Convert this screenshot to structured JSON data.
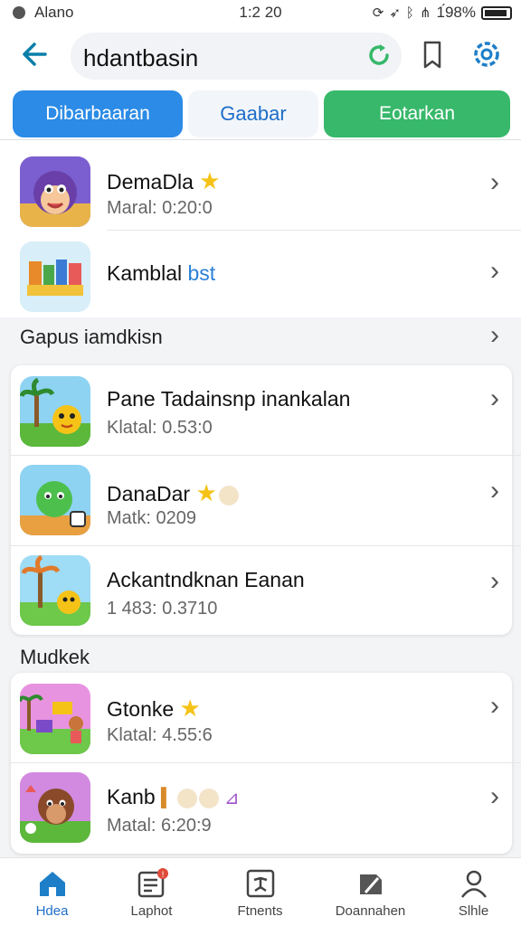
{
  "status": {
    "carrier": "Alano",
    "time": "1:2 20",
    "battery": "1́98%"
  },
  "search": {
    "query": "hdantbasin"
  },
  "tabs": [
    "Dibarbaaran",
    "Gaabar",
    "Eotarkan"
  ],
  "apps_top": [
    {
      "title": "DemaDla",
      "sub": "Maral: 0:20:0",
      "icon": "purple-monster-icon"
    },
    {
      "title": "Kamblal",
      "title_accent": "bst",
      "sub": "",
      "icon": "blocks-game-icon"
    }
  ],
  "section1": {
    "label": "Gapus iamdkisn"
  },
  "card1": [
    {
      "title": "Pane Tadainsnp inankalan",
      "sub": "Klatal: 0.53:0",
      "icon": "palm-cat-icon"
    },
    {
      "title": "DanaDar",
      "sub": "Matk: 0209",
      "icon": "green-dino-icon"
    },
    {
      "title": "Ackantndknan Eanan",
      "sub": "1 483: 0.3710",
      "icon": "palm-chick-icon"
    }
  ],
  "section2": {
    "label": "Mudkek"
  },
  "card2": [
    {
      "title": "Gtonke",
      "sub": "Klatal: 4.55:6",
      "icon": "playground-icon"
    },
    {
      "title": "Kanb",
      "sub": "Matal: 6:20:9",
      "icon": "brown-cat-icon"
    }
  ],
  "nav": [
    {
      "label": "Hdea",
      "icon": "home-icon"
    },
    {
      "label": "Laphot",
      "icon": "news-icon",
      "badge": "!"
    },
    {
      "label": "Ftnents",
      "icon": "events-icon"
    },
    {
      "label": "Doannahen",
      "icon": "download-icon"
    },
    {
      "label": "Slhle",
      "icon": "profile-icon"
    }
  ],
  "colors": {
    "accent": "#2b8be6",
    "green": "#37b86a",
    "star": "#f5c318"
  }
}
